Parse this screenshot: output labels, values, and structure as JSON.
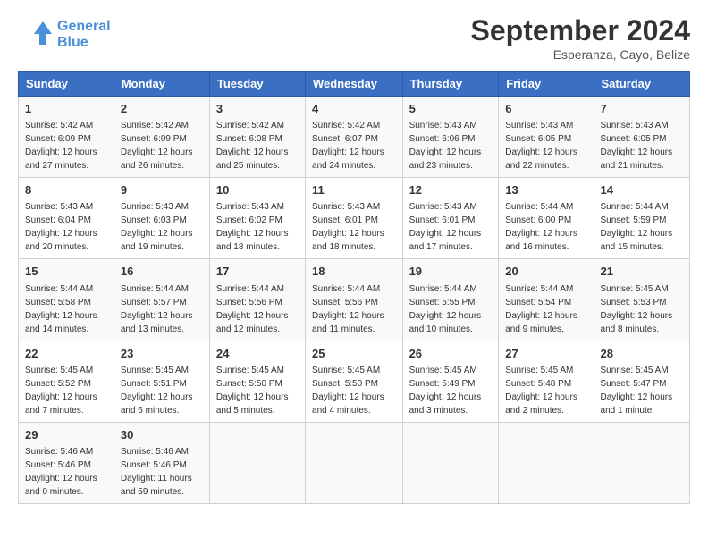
{
  "header": {
    "logo_line1": "General",
    "logo_line2": "Blue",
    "month": "September 2024",
    "location": "Esperanza, Cayo, Belize"
  },
  "days_of_week": [
    "Sunday",
    "Monday",
    "Tuesday",
    "Wednesday",
    "Thursday",
    "Friday",
    "Saturday"
  ],
  "weeks": [
    [
      {
        "day": "1",
        "lines": [
          "Sunrise: 5:42 AM",
          "Sunset: 6:09 PM",
          "Daylight: 12 hours",
          "and 27 minutes."
        ]
      },
      {
        "day": "2",
        "lines": [
          "Sunrise: 5:42 AM",
          "Sunset: 6:09 PM",
          "Daylight: 12 hours",
          "and 26 minutes."
        ]
      },
      {
        "day": "3",
        "lines": [
          "Sunrise: 5:42 AM",
          "Sunset: 6:08 PM",
          "Daylight: 12 hours",
          "and 25 minutes."
        ]
      },
      {
        "day": "4",
        "lines": [
          "Sunrise: 5:42 AM",
          "Sunset: 6:07 PM",
          "Daylight: 12 hours",
          "and 24 minutes."
        ]
      },
      {
        "day": "5",
        "lines": [
          "Sunrise: 5:43 AM",
          "Sunset: 6:06 PM",
          "Daylight: 12 hours",
          "and 23 minutes."
        ]
      },
      {
        "day": "6",
        "lines": [
          "Sunrise: 5:43 AM",
          "Sunset: 6:05 PM",
          "Daylight: 12 hours",
          "and 22 minutes."
        ]
      },
      {
        "day": "7",
        "lines": [
          "Sunrise: 5:43 AM",
          "Sunset: 6:05 PM",
          "Daylight: 12 hours",
          "and 21 minutes."
        ]
      }
    ],
    [
      {
        "day": "8",
        "lines": [
          "Sunrise: 5:43 AM",
          "Sunset: 6:04 PM",
          "Daylight: 12 hours",
          "and 20 minutes."
        ]
      },
      {
        "day": "9",
        "lines": [
          "Sunrise: 5:43 AM",
          "Sunset: 6:03 PM",
          "Daylight: 12 hours",
          "and 19 minutes."
        ]
      },
      {
        "day": "10",
        "lines": [
          "Sunrise: 5:43 AM",
          "Sunset: 6:02 PM",
          "Daylight: 12 hours",
          "and 18 minutes."
        ]
      },
      {
        "day": "11",
        "lines": [
          "Sunrise: 5:43 AM",
          "Sunset: 6:01 PM",
          "Daylight: 12 hours",
          "and 18 minutes."
        ]
      },
      {
        "day": "12",
        "lines": [
          "Sunrise: 5:43 AM",
          "Sunset: 6:01 PM",
          "Daylight: 12 hours",
          "and 17 minutes."
        ]
      },
      {
        "day": "13",
        "lines": [
          "Sunrise: 5:44 AM",
          "Sunset: 6:00 PM",
          "Daylight: 12 hours",
          "and 16 minutes."
        ]
      },
      {
        "day": "14",
        "lines": [
          "Sunrise: 5:44 AM",
          "Sunset: 5:59 PM",
          "Daylight: 12 hours",
          "and 15 minutes."
        ]
      }
    ],
    [
      {
        "day": "15",
        "lines": [
          "Sunrise: 5:44 AM",
          "Sunset: 5:58 PM",
          "Daylight: 12 hours",
          "and 14 minutes."
        ]
      },
      {
        "day": "16",
        "lines": [
          "Sunrise: 5:44 AM",
          "Sunset: 5:57 PM",
          "Daylight: 12 hours",
          "and 13 minutes."
        ]
      },
      {
        "day": "17",
        "lines": [
          "Sunrise: 5:44 AM",
          "Sunset: 5:56 PM",
          "Daylight: 12 hours",
          "and 12 minutes."
        ]
      },
      {
        "day": "18",
        "lines": [
          "Sunrise: 5:44 AM",
          "Sunset: 5:56 PM",
          "Daylight: 12 hours",
          "and 11 minutes."
        ]
      },
      {
        "day": "19",
        "lines": [
          "Sunrise: 5:44 AM",
          "Sunset: 5:55 PM",
          "Daylight: 12 hours",
          "and 10 minutes."
        ]
      },
      {
        "day": "20",
        "lines": [
          "Sunrise: 5:44 AM",
          "Sunset: 5:54 PM",
          "Daylight: 12 hours",
          "and 9 minutes."
        ]
      },
      {
        "day": "21",
        "lines": [
          "Sunrise: 5:45 AM",
          "Sunset: 5:53 PM",
          "Daylight: 12 hours",
          "and 8 minutes."
        ]
      }
    ],
    [
      {
        "day": "22",
        "lines": [
          "Sunrise: 5:45 AM",
          "Sunset: 5:52 PM",
          "Daylight: 12 hours",
          "and 7 minutes."
        ]
      },
      {
        "day": "23",
        "lines": [
          "Sunrise: 5:45 AM",
          "Sunset: 5:51 PM",
          "Daylight: 12 hours",
          "and 6 minutes."
        ]
      },
      {
        "day": "24",
        "lines": [
          "Sunrise: 5:45 AM",
          "Sunset: 5:50 PM",
          "Daylight: 12 hours",
          "and 5 minutes."
        ]
      },
      {
        "day": "25",
        "lines": [
          "Sunrise: 5:45 AM",
          "Sunset: 5:50 PM",
          "Daylight: 12 hours",
          "and 4 minutes."
        ]
      },
      {
        "day": "26",
        "lines": [
          "Sunrise: 5:45 AM",
          "Sunset: 5:49 PM",
          "Daylight: 12 hours",
          "and 3 minutes."
        ]
      },
      {
        "day": "27",
        "lines": [
          "Sunrise: 5:45 AM",
          "Sunset: 5:48 PM",
          "Daylight: 12 hours",
          "and 2 minutes."
        ]
      },
      {
        "day": "28",
        "lines": [
          "Sunrise: 5:45 AM",
          "Sunset: 5:47 PM",
          "Daylight: 12 hours",
          "and 1 minute."
        ]
      }
    ],
    [
      {
        "day": "29",
        "lines": [
          "Sunrise: 5:46 AM",
          "Sunset: 5:46 PM",
          "Daylight: 12 hours",
          "and 0 minutes."
        ]
      },
      {
        "day": "30",
        "lines": [
          "Sunrise: 5:46 AM",
          "Sunset: 5:46 PM",
          "Daylight: 11 hours",
          "and 59 minutes."
        ]
      },
      null,
      null,
      null,
      null,
      null
    ]
  ]
}
